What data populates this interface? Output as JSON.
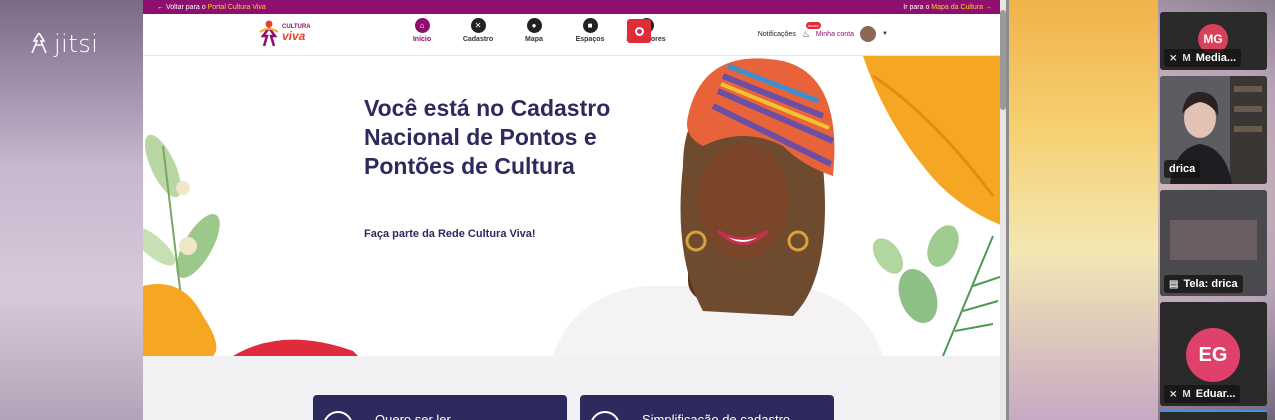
{
  "jitsi": {
    "brand": "jitsi"
  },
  "site": {
    "topstrip": {
      "left_prefix": "← Voltar para o",
      "left_link": "Portal Cultura Viva",
      "right_prefix": "Ir para o",
      "right_link": "Mapa da Cultura →"
    },
    "brand": {
      "line1": "CULTURA",
      "line2": "viva"
    },
    "nav": [
      {
        "label": "Início",
        "icon": "home-icon",
        "glyph": "⌂",
        "active": true
      },
      {
        "label": "Cadastro",
        "icon": "register-icon",
        "glyph": "✕",
        "active": false
      },
      {
        "label": "Mapa",
        "icon": "map-pin-icon",
        "glyph": "●",
        "active": false
      },
      {
        "label": "Espaços",
        "icon": "building-icon",
        "glyph": "■",
        "active": false
      },
      {
        "label": "Indicadores",
        "icon": "chart-icon",
        "glyph": "▲",
        "active": false
      }
    ],
    "notifications_label": "Notificações",
    "notifications_badge": "novas",
    "account_label": "Minha conta",
    "hero": {
      "title": "Você está no Cadastro Nacional de Pontos e Pontões de Cultura",
      "subtitle": "Faça parte da Rede Cultura Viva!"
    },
    "cards": [
      {
        "text": "Quero ser ler..."
      },
      {
        "text": "Simplificação de cadastro"
      }
    ]
  },
  "participants": [
    {
      "initials": "MG",
      "name": "Media...",
      "color": "#d8415a"
    },
    {
      "initials": "",
      "name": "drica",
      "color": "#000000"
    },
    {
      "initials": "",
      "name": "Tela: drica",
      "color": "#000000"
    },
    {
      "initials": "EG",
      "name": "Eduar...",
      "color": "#e0416a"
    }
  ],
  "colors": {
    "brand_purple": "#8e0f6e",
    "hero_navy": "#2d2a5e",
    "accent_orange": "#f5a623",
    "record_red": "#e02b3a"
  }
}
